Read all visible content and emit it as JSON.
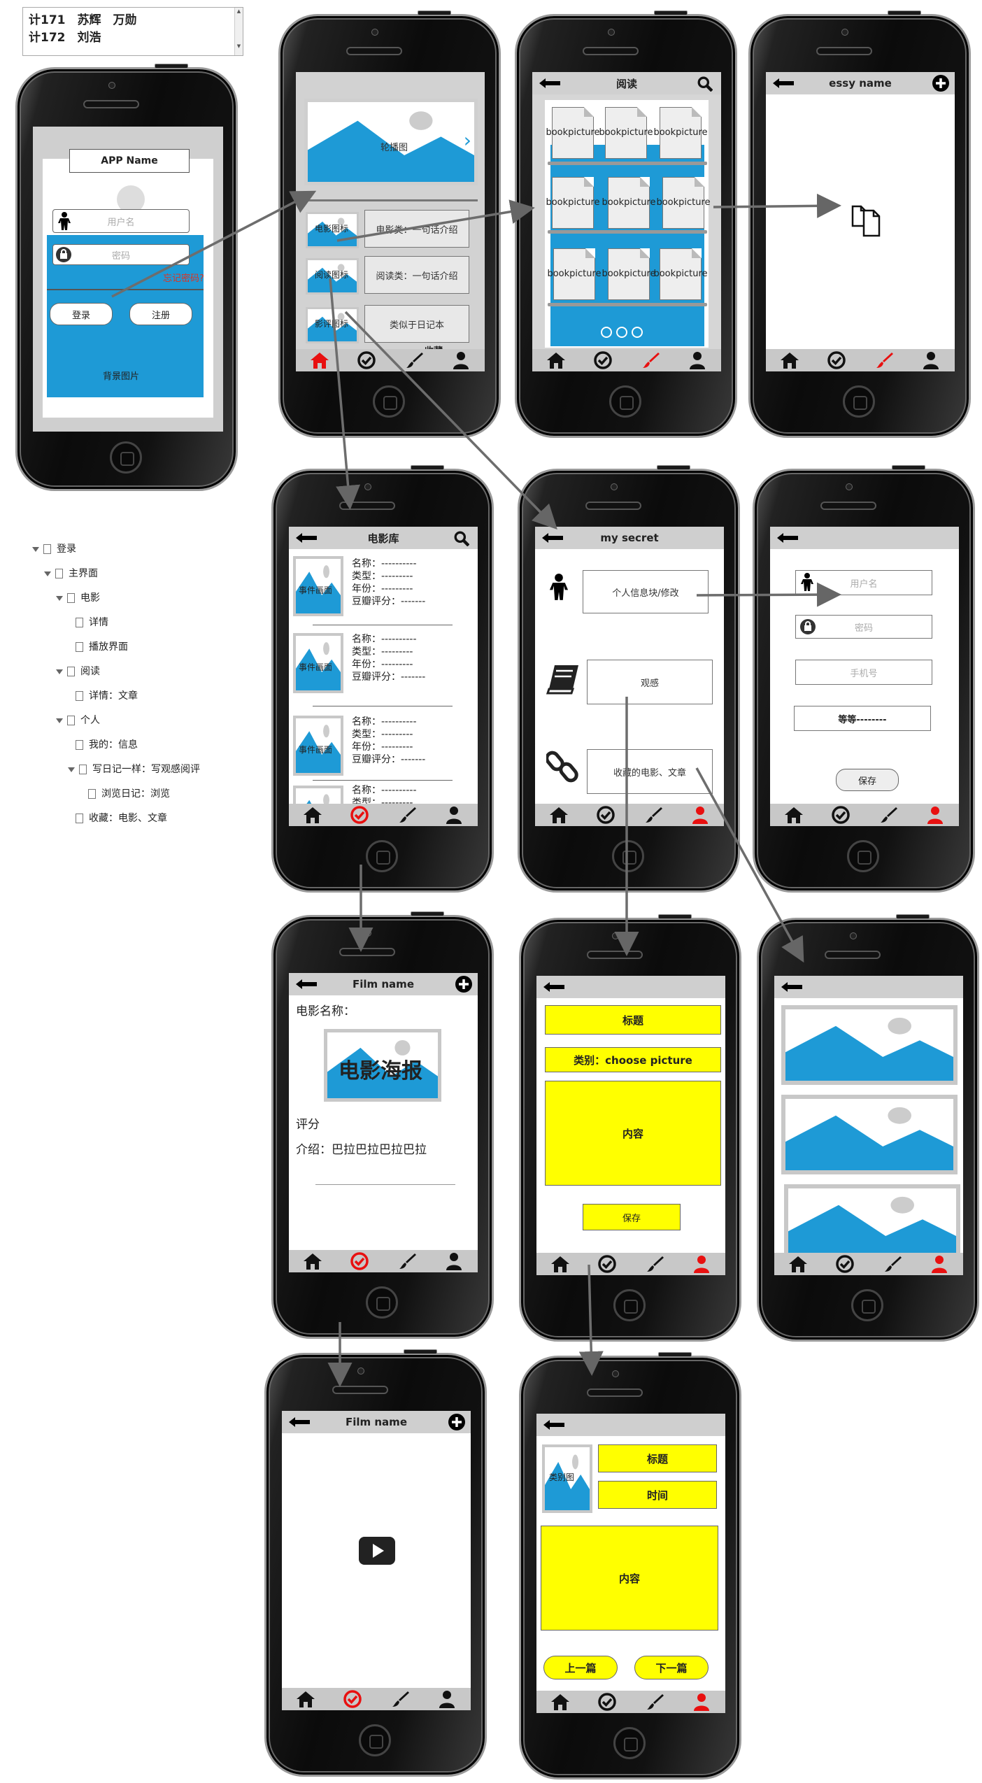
{
  "note": {
    "line1": "计171　苏辉　万勋",
    "line2": "计172　刘浩"
  },
  "tree": [
    {
      "label": "登录",
      "level": 0,
      "arrow": true
    },
    {
      "label": "主界面",
      "level": 1,
      "arrow": true
    },
    {
      "label": "电影",
      "level": 2,
      "arrow": true
    },
    {
      "label": "详情",
      "level": 3,
      "arrow": false
    },
    {
      "label": "播放界面",
      "level": 3,
      "arrow": false
    },
    {
      "label": "阅读",
      "level": 2,
      "arrow": true
    },
    {
      "label": "详情：文章",
      "level": 3,
      "arrow": false
    },
    {
      "label": "个人",
      "level": 2,
      "arrow": true
    },
    {
      "label": "我的：信息",
      "level": 3,
      "arrow": false
    },
    {
      "label": "写日记一样：写观感阅评",
      "level": 3,
      "arrow": true
    },
    {
      "label": "浏览日记：浏览",
      "level": 4,
      "arrow": false
    },
    {
      "label": "收藏：电影、文章",
      "level": 3,
      "arrow": false
    }
  ],
  "login": {
    "app_name": "APP Name",
    "username_ph": "用户名",
    "password_ph": "密码",
    "forgot": "忘记密码?",
    "login_btn": "登录",
    "register_btn": "注册",
    "bg_label": "背景图片"
  },
  "main": {
    "carousel": "轮播图",
    "rows": [
      {
        "icon": "电影图标",
        "text": "电影类：一句话介绍"
      },
      {
        "icon": "阅读图标",
        "text": "阅读类：一句话介绍"
      },
      {
        "icon": "影评图标",
        "text": "类似于日记本"
      }
    ],
    "fav": "收藏"
  },
  "reading": {
    "title": "阅读",
    "book_line1": "book",
    "book_line2": "picture"
  },
  "essay": {
    "title": "essy name"
  },
  "movies": {
    "title": "电影库",
    "poster": "事件画面",
    "items": [
      "名称：----------",
      "类型：---------",
      "年份：---------",
      "豆瓣评分：-------"
    ]
  },
  "secret": {
    "title": "my  secret",
    "info": "个人信息块/修改",
    "review": "观感",
    "fav": "收藏的电影、文章"
  },
  "edit": {
    "username_ph": "用户名",
    "password_ph": "密码",
    "phone_ph": "手机号",
    "etc": "等等--------",
    "save": "保存"
  },
  "film_detail": {
    "title": "Film name",
    "name_label": "电影名称：",
    "poster": "电影海报",
    "rating": "评分",
    "intro": "介绍：巴拉巴拉巴拉巴拉"
  },
  "write": {
    "title_field": "标题",
    "category": "类别：choose picture",
    "content": "内容",
    "save": "保存"
  },
  "player": {
    "title": "Film name"
  },
  "article": {
    "category": "类别图",
    "title_field": "标题",
    "time": "时间",
    "content": "内容",
    "prev": "上一篇",
    "next": "下一篇"
  },
  "colors": {
    "blue": "#1e9ad6",
    "yellow": "#ffff00",
    "active": "#e81010",
    "hdr": "#cfcfcf"
  }
}
